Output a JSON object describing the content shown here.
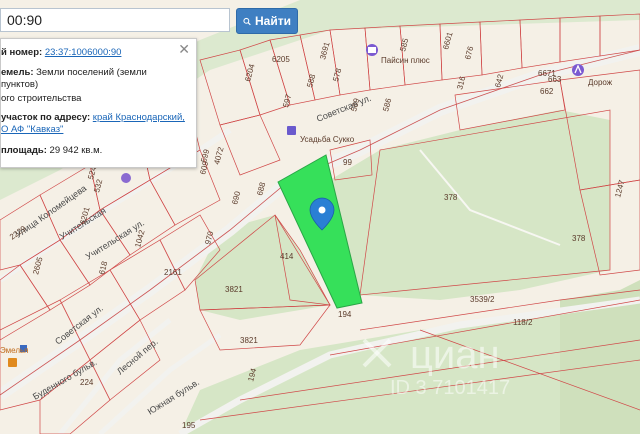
{
  "search": {
    "value": "00:90",
    "button_label": "Найти"
  },
  "info_panel": {
    "cadastral_label": "й номер:",
    "cadastral_number": "23:37:1006000:90",
    "land_category_label": "емель:",
    "land_category_value_1": "Земли поселений (земли",
    "land_category_value_2": "пунктов)",
    "land_use_value": "ого строительства",
    "address_label": "участок по адресу:",
    "address_value_1": "край Краснодарский,",
    "address_value_2": "О АФ \"Кавказ\"",
    "area_label": "площадь:",
    "area_value": "29 942 кв.м."
  },
  "map": {
    "streets": {
      "sovetskaya_top": "Советская ул.",
      "sovetskaya_bottom": "Советская ул.",
      "kolomeytseva": "Улица Коломейцева",
      "uchitelskaya_1": "Учительская",
      "uchitelskaya_2": "Учительская ул.",
      "lesnaya": "Лесной пер.",
      "budennogo": "Буденного бульв.",
      "yuzhnaya": "Южная бульв.",
      "emelya": "Эмелья"
    },
    "pois": {
      "pharmacy": "Пайсин плюс",
      "shop": "Усадьба Сукко",
      "doroga": "Дорож"
    },
    "parcels": [
      "99",
      "378",
      "378",
      "414",
      "3821",
      "3821",
      "194",
      "194",
      "195",
      "3539/2",
      "118/2",
      "224",
      "6204",
      "6205",
      "597",
      "588",
      "578",
      "589",
      "585",
      "586",
      "316",
      "663",
      "662",
      "6671",
      "642",
      "688",
      "690",
      "970",
      "618",
      "599",
      "609",
      "4072",
      "1042",
      "1247",
      "2161",
      "2229",
      "2605",
      "6201",
      "524",
      "532",
      "6601",
      "676",
      "3691"
    ],
    "colors": {
      "selected_parcel": "#36e05a",
      "parcel_border": "#d04848",
      "green_area": "#d8e8c8",
      "road": "#f3f3f0",
      "base": "#f5f0e6"
    }
  },
  "watermark": {
    "brand": "циан",
    "id": "ID 3 7101417"
  }
}
